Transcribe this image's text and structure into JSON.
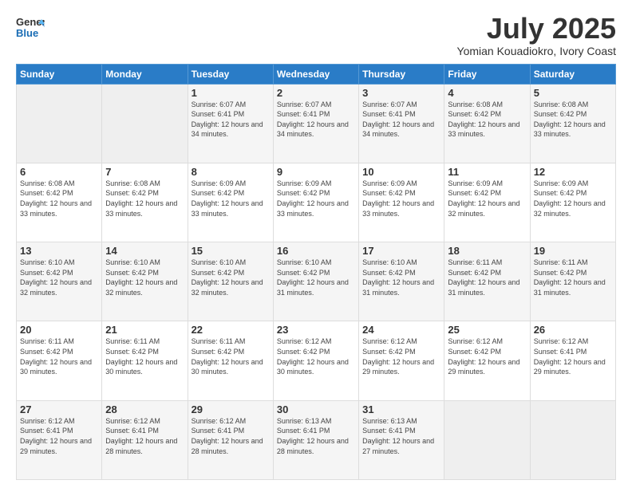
{
  "logo": {
    "general": "General",
    "blue": "Blue"
  },
  "header": {
    "title": "July 2025",
    "subtitle": "Yomian Kouadiokro, Ivory Coast"
  },
  "weekdays": [
    "Sunday",
    "Monday",
    "Tuesday",
    "Wednesday",
    "Thursday",
    "Friday",
    "Saturday"
  ],
  "weeks": [
    [
      {
        "day": "",
        "info": ""
      },
      {
        "day": "",
        "info": ""
      },
      {
        "day": "1",
        "info": "Sunrise: 6:07 AM\nSunset: 6:41 PM\nDaylight: 12 hours and 34 minutes."
      },
      {
        "day": "2",
        "info": "Sunrise: 6:07 AM\nSunset: 6:41 PM\nDaylight: 12 hours and 34 minutes."
      },
      {
        "day": "3",
        "info": "Sunrise: 6:07 AM\nSunset: 6:41 PM\nDaylight: 12 hours and 34 minutes."
      },
      {
        "day": "4",
        "info": "Sunrise: 6:08 AM\nSunset: 6:42 PM\nDaylight: 12 hours and 33 minutes."
      },
      {
        "day": "5",
        "info": "Sunrise: 6:08 AM\nSunset: 6:42 PM\nDaylight: 12 hours and 33 minutes."
      }
    ],
    [
      {
        "day": "6",
        "info": "Sunrise: 6:08 AM\nSunset: 6:42 PM\nDaylight: 12 hours and 33 minutes."
      },
      {
        "day": "7",
        "info": "Sunrise: 6:08 AM\nSunset: 6:42 PM\nDaylight: 12 hours and 33 minutes."
      },
      {
        "day": "8",
        "info": "Sunrise: 6:09 AM\nSunset: 6:42 PM\nDaylight: 12 hours and 33 minutes."
      },
      {
        "day": "9",
        "info": "Sunrise: 6:09 AM\nSunset: 6:42 PM\nDaylight: 12 hours and 33 minutes."
      },
      {
        "day": "10",
        "info": "Sunrise: 6:09 AM\nSunset: 6:42 PM\nDaylight: 12 hours and 33 minutes."
      },
      {
        "day": "11",
        "info": "Sunrise: 6:09 AM\nSunset: 6:42 PM\nDaylight: 12 hours and 32 minutes."
      },
      {
        "day": "12",
        "info": "Sunrise: 6:09 AM\nSunset: 6:42 PM\nDaylight: 12 hours and 32 minutes."
      }
    ],
    [
      {
        "day": "13",
        "info": "Sunrise: 6:10 AM\nSunset: 6:42 PM\nDaylight: 12 hours and 32 minutes."
      },
      {
        "day": "14",
        "info": "Sunrise: 6:10 AM\nSunset: 6:42 PM\nDaylight: 12 hours and 32 minutes."
      },
      {
        "day": "15",
        "info": "Sunrise: 6:10 AM\nSunset: 6:42 PM\nDaylight: 12 hours and 32 minutes."
      },
      {
        "day": "16",
        "info": "Sunrise: 6:10 AM\nSunset: 6:42 PM\nDaylight: 12 hours and 31 minutes."
      },
      {
        "day": "17",
        "info": "Sunrise: 6:10 AM\nSunset: 6:42 PM\nDaylight: 12 hours and 31 minutes."
      },
      {
        "day": "18",
        "info": "Sunrise: 6:11 AM\nSunset: 6:42 PM\nDaylight: 12 hours and 31 minutes."
      },
      {
        "day": "19",
        "info": "Sunrise: 6:11 AM\nSunset: 6:42 PM\nDaylight: 12 hours and 31 minutes."
      }
    ],
    [
      {
        "day": "20",
        "info": "Sunrise: 6:11 AM\nSunset: 6:42 PM\nDaylight: 12 hours and 30 minutes."
      },
      {
        "day": "21",
        "info": "Sunrise: 6:11 AM\nSunset: 6:42 PM\nDaylight: 12 hours and 30 minutes."
      },
      {
        "day": "22",
        "info": "Sunrise: 6:11 AM\nSunset: 6:42 PM\nDaylight: 12 hours and 30 minutes."
      },
      {
        "day": "23",
        "info": "Sunrise: 6:12 AM\nSunset: 6:42 PM\nDaylight: 12 hours and 30 minutes."
      },
      {
        "day": "24",
        "info": "Sunrise: 6:12 AM\nSunset: 6:42 PM\nDaylight: 12 hours and 29 minutes."
      },
      {
        "day": "25",
        "info": "Sunrise: 6:12 AM\nSunset: 6:42 PM\nDaylight: 12 hours and 29 minutes."
      },
      {
        "day": "26",
        "info": "Sunrise: 6:12 AM\nSunset: 6:41 PM\nDaylight: 12 hours and 29 minutes."
      }
    ],
    [
      {
        "day": "27",
        "info": "Sunrise: 6:12 AM\nSunset: 6:41 PM\nDaylight: 12 hours and 29 minutes."
      },
      {
        "day": "28",
        "info": "Sunrise: 6:12 AM\nSunset: 6:41 PM\nDaylight: 12 hours and 28 minutes."
      },
      {
        "day": "29",
        "info": "Sunrise: 6:12 AM\nSunset: 6:41 PM\nDaylight: 12 hours and 28 minutes."
      },
      {
        "day": "30",
        "info": "Sunrise: 6:13 AM\nSunset: 6:41 PM\nDaylight: 12 hours and 28 minutes."
      },
      {
        "day": "31",
        "info": "Sunrise: 6:13 AM\nSunset: 6:41 PM\nDaylight: 12 hours and 27 minutes."
      },
      {
        "day": "",
        "info": ""
      },
      {
        "day": "",
        "info": ""
      }
    ]
  ]
}
